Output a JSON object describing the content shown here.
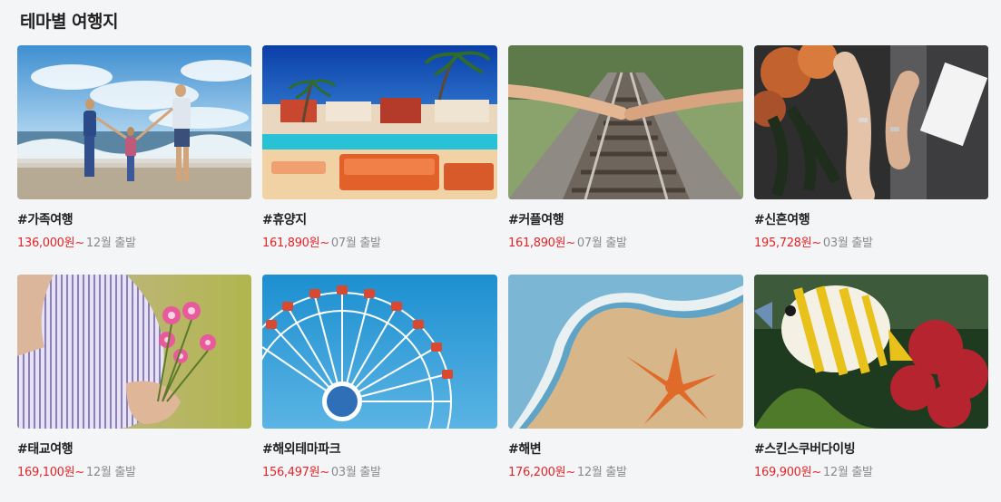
{
  "section_title": "테마별 여행지",
  "cards": [
    {
      "tag": "#가족여행",
      "price": "136,000원~",
      "date": "12월 출발",
      "image": "family-beach-photo"
    },
    {
      "tag": "#휴양지",
      "price": "161,890원~",
      "date": "07월 출발",
      "image": "resort-pool-photo"
    },
    {
      "tag": "#커플여행",
      "price": "161,890원~",
      "date": "07월 출발",
      "image": "couple-railway-photo"
    },
    {
      "tag": "#신혼여행",
      "price": "195,728원~",
      "date": "03월 출발",
      "image": "wedding-rings-photo"
    },
    {
      "tag": "#태교여행",
      "price": "169,100원~",
      "date": "12월 출발",
      "image": "pregnancy-flowers-photo"
    },
    {
      "tag": "#해외테마파크",
      "price": "156,497원~",
      "date": "03월 출발",
      "image": "ferris-wheel-photo"
    },
    {
      "tag": "#해변",
      "price": "176,200원~",
      "date": "12월 출발",
      "image": "starfish-beach-photo"
    },
    {
      "tag": "#스킨스쿠버다이빙",
      "price": "169,900원~",
      "date": "12월 출발",
      "image": "tropical-fish-photo"
    }
  ],
  "colors": {
    "price": "#e52528",
    "date": "#8a8a8a",
    "background": "#f4f5f7"
  }
}
